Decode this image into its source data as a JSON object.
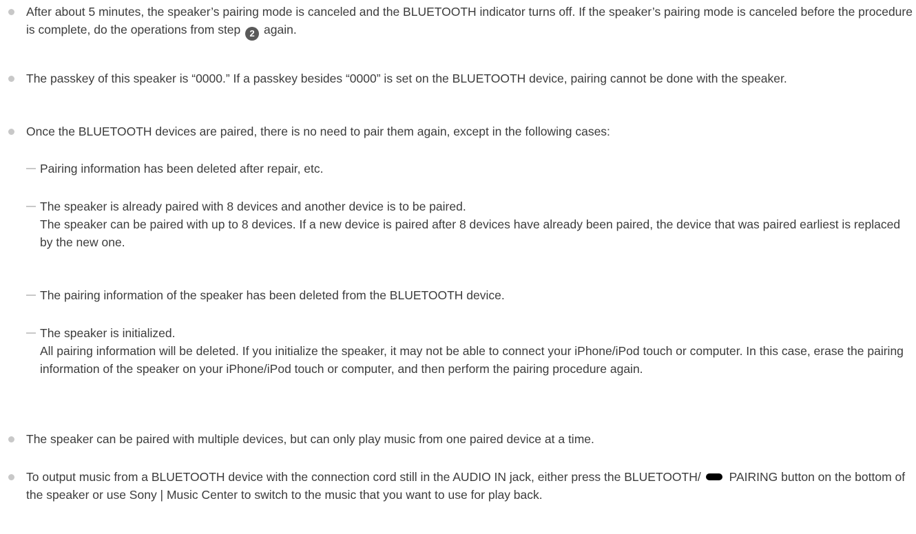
{
  "notes": [
    {
      "text_before_step": "After about 5 minutes, the speaker’s pairing mode is canceled and the BLUETOOTH indicator turns off. If the speaker’s pairing mode is canceled before the procedure is complete, do the operations from step",
      "step_number": "2",
      "text_after_step": "again."
    },
    {
      "text": "The passkey of this speaker is “0000.” If a passkey besides “0000” is set on the BLUETOOTH device, pairing cannot be done with the speaker."
    },
    {
      "text": "Once the BLUETOOTH devices are paired, there is no need to pair them again, except in the following cases:",
      "subitems": [
        {
          "text": "Pairing information has been deleted after repair, etc."
        },
        {
          "text": "The speaker is already paired with 8 devices and another device is to be paired.",
          "extra": "The speaker can be paired with up to 8 devices. If a new device is paired after 8 devices have already been paired, the device that was paired earliest is replaced by the new one."
        },
        {
          "text": "The pairing information of the speaker has been deleted from the BLUETOOTH device."
        },
        {
          "text": "The speaker is initialized.",
          "extra": "All pairing information will be deleted. If you initialize the speaker, it may not be able to connect your iPhone/iPod touch or computer. In this case, erase the pairing information of the speaker on your iPhone/iPod touch or computer, and then perform the pairing procedure again."
        }
      ]
    },
    {
      "text": "The speaker can be paired with multiple devices, but can only play music from one paired device at a time."
    },
    {
      "text_before_icon": "To output music from a BLUETOOTH device with the connection cord still in the AUDIO IN jack, either press the BLUETOOTH/",
      "icon": "pairing-button-icon",
      "text_after_icon": "PAIRING button on the bottom of the speaker or use Sony | Music Center to switch to the music that you want to use for play back."
    }
  ]
}
